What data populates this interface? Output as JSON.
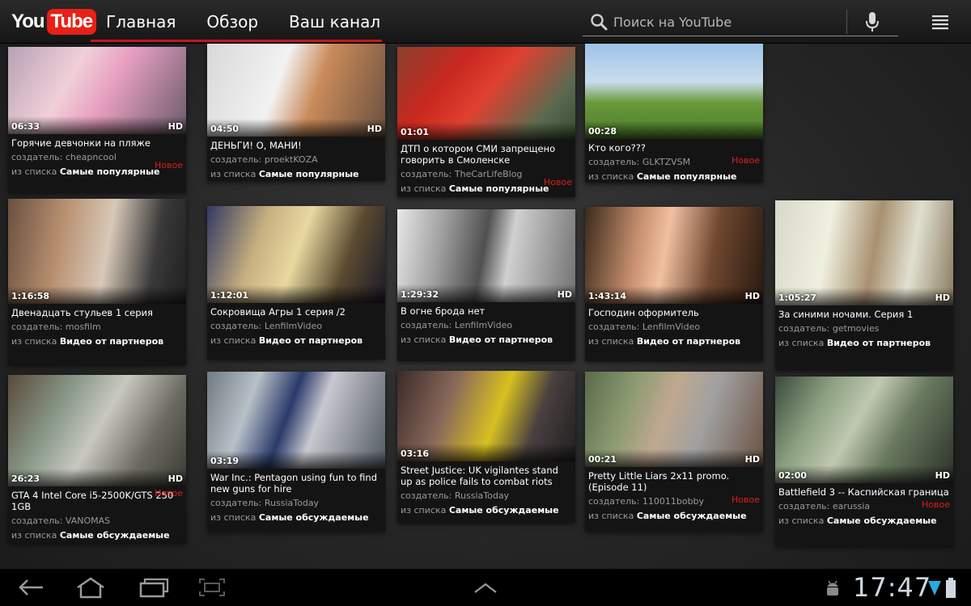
{
  "app": {
    "logo_you": "You",
    "logo_tube": "Tube",
    "accent_color": "#c4161c"
  },
  "tabs": [
    {
      "label": "Главная"
    },
    {
      "label": "Обзор"
    },
    {
      "label": "Ваш канал"
    }
  ],
  "search": {
    "placeholder": "Поиск на YouTube"
  },
  "labels": {
    "creator_prefix": "создатель:",
    "list_prefix": "из списка",
    "new": "Новое",
    "hd": "HD"
  },
  "videos": [
    {
      "duration": "06:33",
      "hd": true,
      "title": "Горячие девчонки на пляже",
      "creator": "cheapncool",
      "list": "Самые популярные",
      "is_new": true
    },
    {
      "duration": "04:50",
      "hd": true,
      "title": "ДЕНЬГИ! О, МАНИ!",
      "creator": "proektKOZA",
      "list": "Самые популярные",
      "is_new": false
    },
    {
      "duration": "01:01",
      "hd": false,
      "title": "ДТП о котором СМИ запрещено говорить в Смоленске",
      "creator": "TheCarLifeBlog",
      "list": "Самые популярные",
      "is_new": true
    },
    {
      "duration": "00:28",
      "hd": false,
      "title": "Кто кого???",
      "creator": "GLKTZVSM",
      "list": "Самые популярные",
      "is_new": true
    },
    {
      "duration": "1:16:58",
      "hd": false,
      "title": "Двенадцать стульев 1 серия",
      "creator": "mosfilm",
      "list": "Видео от партнеров",
      "is_new": false
    },
    {
      "duration": "1:12:01",
      "hd": false,
      "title": "Сокровища Агры 1 серия /2",
      "creator": "LenfilmVideo",
      "list": "Видео от партнеров",
      "is_new": false
    },
    {
      "duration": "1:29:32",
      "hd": true,
      "title": "В огне брода нет",
      "creator": "LenfilmVideo",
      "list": "Видео от партнеров",
      "is_new": false
    },
    {
      "duration": "1:43:14",
      "hd": true,
      "title": "Господин оформитель",
      "creator": "LenfilmVideo",
      "list": "Видео от партнеров",
      "is_new": false
    },
    {
      "duration": "1:05:27",
      "hd": true,
      "title": "За синими ночами. Серия 1",
      "creator": "getmovies",
      "list": "Видео от партнеров",
      "is_new": false
    },
    {
      "duration": "26:23",
      "hd": true,
      "title": "GTA 4 Intel Core i5-2500K/GTS 250 1GB",
      "creator": "VANOMAS",
      "list": "Самые обсуждаемые",
      "is_new": true
    },
    {
      "duration": "03:19",
      "hd": false,
      "title": "War Inc.: Pentagon using fun to find new guns for hire",
      "creator": "RussiaToday",
      "list": "Самые обсуждаемые",
      "is_new": false
    },
    {
      "duration": "03:16",
      "hd": false,
      "title": "Street Justice: UK vigilantes stand up as police fails to combat riots",
      "creator": "RussiaToday",
      "list": "Самые обсуждаемые",
      "is_new": false
    },
    {
      "duration": "00:21",
      "hd": true,
      "title": "Pretty Little Liars 2x11 promo. (Episode 11)",
      "creator": "110011bobby",
      "list": "Самые обсуждаемые",
      "is_new": true
    },
    {
      "duration": "02:00",
      "hd": true,
      "title": "Battlefield 3 -- Каспийская граница",
      "creator": "earussia",
      "list": "Самые обсуждаемые",
      "is_new": true
    }
  ],
  "system": {
    "clock": "17:47"
  }
}
